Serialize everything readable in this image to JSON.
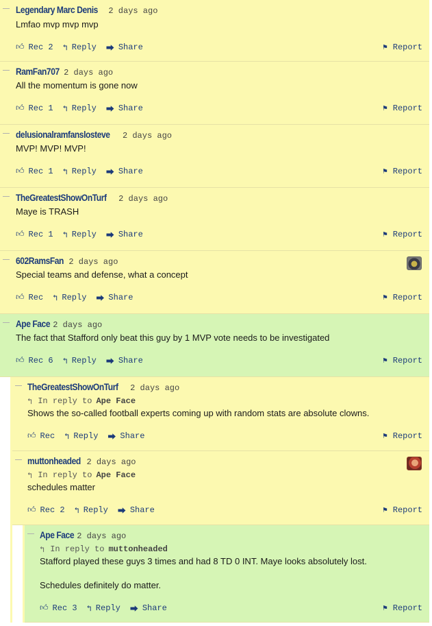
{
  "labels": {
    "rec": "Rec",
    "reply": "Reply",
    "share": "Share",
    "report": "Report",
    "in_reply_to": "In reply to"
  },
  "comments": [
    {
      "author": "Legendary Marc Denis",
      "time": "2 days ago",
      "body": [
        "Lmfao mvp mvp mvp"
      ],
      "rec_count": "2",
      "highlight": "yellow"
    },
    {
      "author": "RamFan707",
      "time": "2 days ago",
      "body": [
        "All the momentum is gone now"
      ],
      "rec_count": "1",
      "highlight": "yellow"
    },
    {
      "author": "delusionalramfanslosteve",
      "time": "2 days ago",
      "body": [
        "MVP! MVP! MVP!"
      ],
      "rec_count": "1",
      "highlight": "yellow"
    },
    {
      "author": "TheGreatestShowOnTurf",
      "time": "2 days ago",
      "body": [
        "Maye is TRASH"
      ],
      "rec_count": "1",
      "highlight": "yellow"
    },
    {
      "author": "602RamsFan",
      "time": "2 days ago",
      "body": [
        "Special teams and defense, what a concept"
      ],
      "rec_count": "",
      "highlight": "yellow",
      "avatar": "helmet-avatar"
    },
    {
      "author": "Ape Face",
      "time": "2 days ago",
      "body": [
        "The fact that Stafford only beat this guy by 1 MVP vote needs to be investigated"
      ],
      "rec_count": "6",
      "highlight": "green"
    },
    {
      "author": "TheGreatestShowOnTurf",
      "time": "2 days ago",
      "reply_to": "Ape Face",
      "body": [
        "Shows the so-called football experts coming up with random stats are absolute clowns."
      ],
      "rec_count": "",
      "highlight": "yellow"
    },
    {
      "author": "muttonheaded",
      "time": "2 days ago",
      "reply_to": "Ape Face",
      "body": [
        "schedules matter"
      ],
      "rec_count": "2",
      "highlight": "yellow",
      "avatar": "person-avatar"
    },
    {
      "author": "Ape Face",
      "time": "2 days ago",
      "reply_to": "muttonheaded",
      "body": [
        "Stafford played these guys 3 times and had 8 TD 0 INT. Maye looks absolutely lost.",
        "Schedules definitely do matter."
      ],
      "rec_count": "3",
      "highlight": "green"
    }
  ],
  "colors": {
    "yellow_bg": "#fcf9b0",
    "green_bg": "#d6f5b5",
    "author": "#1c3b7a"
  },
  "icons": {
    "rec": "thumbs-up-icon",
    "reply": "reply-arrow-icon",
    "share": "share-icon",
    "report": "flag-icon",
    "collapse": "collapse-line-icon"
  }
}
